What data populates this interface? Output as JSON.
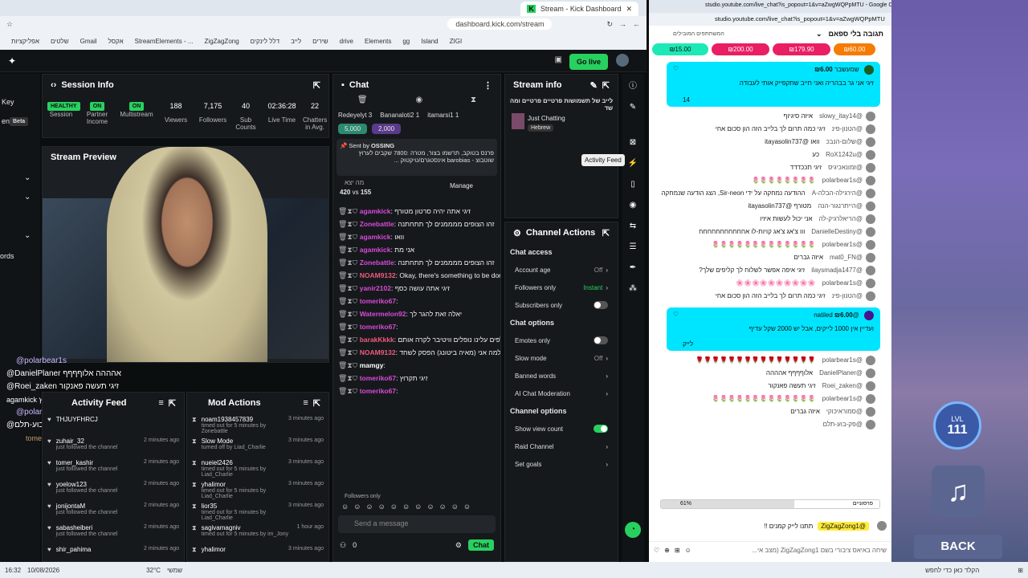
{
  "browser": {
    "tab_title": "Stream - Kick Dashboard",
    "url": "dashboard.kick.com/stream",
    "bookmarks": [
      "ZIGI",
      "Island",
      "gg",
      "Elements",
      "drive",
      "שירים",
      "לייב",
      "דלל לינקים",
      "ZigZagZong",
      "StreamElements - ...",
      "אקסל",
      "Gmail",
      "שלטים",
      "אפליקציות"
    ]
  },
  "kick": {
    "go_live": "Go live",
    "session": {
      "title": "Session Info",
      "badges": [
        "HEALTHY",
        "ON",
        "ON"
      ],
      "stats": [
        {
          "value": "188",
          "label": "Viewers"
        },
        {
          "value": "7,175",
          "label": "Followers"
        },
        {
          "value": "40",
          "label": "Sub Counts"
        },
        {
          "value": "02:36:28",
          "label": "Live Time"
        },
        {
          "value": "22",
          "label": "Chatters in Avg."
        }
      ],
      "badge_labels": [
        "Session",
        "Partner Income",
        "Multistream"
      ]
    },
    "left_labels": [
      "Key",
      "ent",
      "Beta",
      "ords"
    ],
    "stream_preview": "Stream Preview",
    "overlay_chat": [
      "@polarbear1s",
      "@DanielPlaner אהההה אלוףףףף",
      "@Roei_zaken זיגי תעשה פאנקור",
      "agamkick זיגי תקרוץ",
      "@polarbear1s",
      "@פק-בוע-תלם",
      "tomeriko67"
    ],
    "chat": {
      "title": "Chat",
      "top_users": [
        "Redeyelyt 3",
        "Bananaloti2 1",
        "itamarsi1 1"
      ],
      "kicks": [
        "5,000",
        "2,000"
      ],
      "pinned_by": "OSSING",
      "pinned_text": "פרנס בטוקב, תרשמו בצור, מטרה :7800 שקבים לערוץ שוטבוצ - barobias אינסטגרם/טיקטוק ...",
      "poll": {
        "label": "מה יצא",
        "a": "420",
        "vs": "vs",
        "b": "155",
        "manage": "Manage"
      },
      "messages": [
        {
          "user": "agamkick",
          "color": "#d94ad9",
          "text": "זיגי אתה יהיה סרטון מטורף"
        },
        {
          "user": "Zonebattle",
          "color": "#d94ad9",
          "text": "זהו הצופים ממממנים לך תתחתנה"
        },
        {
          "user": "agamkick",
          "color": "#d94ad9",
          "text": "וואו"
        },
        {
          "user": "agamkick",
          "color": "#d94ad9",
          "text": "אני מת"
        },
        {
          "user": "Zonebattle",
          "color": "#d94ad9",
          "text": "זהו הצופים ממממנים לך תתחתנה"
        },
        {
          "user": "NOAM9132",
          "color": "#f05a7e",
          "text": "Okay, there's something to be done about that."
        },
        {
          "user": "yanir2102",
          "color": "#d94ad9",
          "text": "זיגי אתה עושה כסף"
        },
        {
          "user": "tomeriko67",
          "color": "#d94ad9",
          "text": ""
        },
        {
          "user": "Watermelon92",
          "color": "#d94ad9",
          "text": "יאלה זאת להגר לך"
        },
        {
          "user": "tomeriko67",
          "color": "#d94ad9",
          "text": ""
        },
        {
          "user": "barakKkkk",
          "color": "#f05a7e",
          "text": "אלפים אלפים עלינו נופלים וויטיבר לקרה אותם"
        },
        {
          "user": "NOAM9132",
          "color": "#f05a7e",
          "text": "שאלה לא קשורה אבל אתה יודע למה אני (מאיה ביטונג) הפסק לשחד"
        },
        {
          "user": "mamgy",
          "color": "#fff",
          "text": ""
        },
        {
          "user": "tomeriko67",
          "color": "#d94ad9",
          "text": "זיגי תקרוץ"
        },
        {
          "user": "tomeriko67",
          "color": "#d94ad9",
          "text": ""
        }
      ],
      "followers_only": "Followers only",
      "placeholder": "Send a message",
      "points": "0",
      "send": "Chat"
    },
    "stream_info": {
      "title": "Stream info",
      "stream_title": "לייב של תשמושות פרטיים פרטיים ומה שד",
      "category": "Just Chatting",
      "lang": "Hebrew",
      "activity_feed_tip": "Activity Feed"
    },
    "channel_actions": {
      "title": "Channel Actions",
      "access": "Chat access",
      "rows1": [
        {
          "label": "Account age",
          "value": "Off"
        },
        {
          "label": "Followers only",
          "value": "Instant"
        },
        {
          "label": "Subscribers only",
          "value": ""
        }
      ],
      "options": "Chat options",
      "rows2": [
        {
          "label": "Emotes only",
          "value": ""
        },
        {
          "label": "Slow mode",
          "value": "Off"
        },
        {
          "label": "Banned words",
          "value": ""
        },
        {
          "label": "AI Chat Moderation",
          "value": ""
        }
      ],
      "channel_options": "Channel options",
      "rows3": [
        {
          "label": "Show view count",
          "value": ""
        },
        {
          "label": "Raid Channel",
          "value": ""
        },
        {
          "label": "Set goals",
          "value": ""
        }
      ]
    },
    "activity": {
      "title": "Activity Feed",
      "items": [
        {
          "user": "THJUYFHRCJ",
          "sub": "",
          "time": ""
        },
        {
          "user": "zuhair_32",
          "sub": "just followed the channel",
          "time": "2 minutes ago"
        },
        {
          "user": "tomer_kashir",
          "sub": "just followed the channel",
          "time": "2 minutes ago"
        },
        {
          "user": "yoelow123",
          "sub": "just followed the channel",
          "time": "2 minutes ago"
        },
        {
          "user": "jonijontaM",
          "sub": "just followed the channel",
          "time": "2 minutes ago"
        },
        {
          "user": "sabasheiberi",
          "sub": "just followed the channel",
          "time": "2 minutes ago"
        },
        {
          "user": "shir_pahima",
          "sub": "",
          "time": "2 minutes ago"
        }
      ]
    },
    "mod": {
      "title": "Mod Actions",
      "items": [
        {
          "user": "noam1938457839",
          "sub": "timed out for 5 minutes by Zonebattle",
          "time": "3 minutes ago"
        },
        {
          "user": "Slow Mode",
          "sub": "turned off by Liad_Charlie",
          "time": "3 minutes ago"
        },
        {
          "user": "nueiel2426",
          "sub": "timed out for 5 minutes by Liad_Charlie",
          "time": "3 minutes ago"
        },
        {
          "user": "yhalimor",
          "sub": "timed out for 5 minutes by Liad_Charlie",
          "time": "3 minutes ago"
        },
        {
          "user": "lior35",
          "sub": "timed out for 5 minutes by Liad_Charlie",
          "time": "3 minutes ago"
        },
        {
          "user": "sagivamagniv",
          "sub": "timed out for 5 minutes by im_Jony",
          "time": "1 hour ago"
        },
        {
          "user": "yhalimor",
          "sub": "",
          "time": "3 minutes ago"
        }
      ]
    }
  },
  "yt": {
    "window_title": "studio.youtube.com/live_chat?is_popout=1&v=aZwgWQPpMTU - Google Chrome",
    "url": "studio.youtube.com/live_chat?is_popout=1&v=aZwgWQPpMTU",
    "header": "תגובה בלי ספאם",
    "subheader": "המשתתפים המובילים",
    "superchats": [
      "₪15.00",
      "₪200.00",
      "₪179.90",
      "₪60.00"
    ],
    "sc1": {
      "name": "שמעשבר",
      "amount": "₪6.00",
      "text": "זיגי אני גר בבהריה ואני חייב שתקפייק אותי לעבודה",
      "likes": "14"
    },
    "messages": [
      {
        "user": "@slowy_itay14",
        "text": "איזה סיגיוף"
      },
      {
        "user": "@הטנון-פינ",
        "text": "זיגי כמה תרום לך בלייב הזה הון סכום אחי"
      },
      {
        "user": "@שלום-הנבכ",
        "text": "וואו @itayasolin737"
      },
      {
        "user": "@RoX1242u",
        "text": "כע"
      },
      {
        "user": "@זמונאכיגיס",
        "text": "זיגי תככדדד"
      },
      {
        "user": "@polarbear1s",
        "text": "🌷🌷🌷🌷🌷🌷🌷🌷"
      },
      {
        "user": "@הירגילה-הבלה-A",
        "text": "ההודעה נמחקה על ידי Sir-neon, הצג הודעה שנמחקה"
      },
      {
        "user": "@הייתרנגור-הנה",
        "text": "מטורף @itayasolin737"
      },
      {
        "user": "@הריאלרגיק-לה",
        "text": "אני יכול לעשות איזיו"
      },
      {
        "user": "@DanielleDestiny",
        "text": "ווו צ'אג צ'אג קויות-לו אחחחחחחחחחחח"
      },
      {
        "user": "@polarbear1s",
        "text": "🌷🌷🌷🌷🌷🌷🌷🌷🌷🌷🌷🌷🌷"
      },
      {
        "user": "@mat0_FN",
        "text": "איזה גברים"
      },
      {
        "user": "@ilaysmadja1477",
        "text": "זיגי איפה אפשר לשלוח לך קליפים שלך?"
      },
      {
        "user": "@polarbear1s",
        "text": "🌸🌸🌸🌸🌸🌸🌸🌸🌸🌸"
      },
      {
        "user": "@הטנון-פינ",
        "text": "זיגי כמה תרום לך בלייב הזה הון סכום אחי"
      }
    ],
    "sc2": {
      "name": "@natiled",
      "amount": "₪6.00",
      "text": "ועדיין אין 1000 לייקים, אבל יש 2000 שקל עדיף",
      "likes": "לייק"
    },
    "messages2": [
      {
        "user": "@polarbear1s",
        "text": "🌹🌹🌹🌹🌹🌹🌹🌹🌹🌹🌹🌹🌹🌹🌹"
      },
      {
        "user": "@DanielPlaner",
        "text": "אלוףףףף אהההה"
      },
      {
        "user": "@Roei_zaken",
        "text": "זיגי תעשה פאנקור"
      },
      {
        "user": "@polarbear1s",
        "text": "🌷🌷🌷🌷🌷🌷🌷🌷🌷🌷🌷🌷🌷"
      },
      {
        "user": "@סמוראיכוקי",
        "text": "איזה גברים"
      },
      {
        "user": "@פק-בוע-תלם",
        "text": ""
      }
    ],
    "progress_label": "61%",
    "progress_value": 0.61,
    "progress_right": "פרסוניים",
    "pinned_user": "@ZigZagZong1",
    "pinned_text": "תתנו לייק קמנים !!",
    "input_placeholder": "שיחה באיאס ציבורי בשם ZigZagZong1 (מצב אי..."
  },
  "game": {
    "level_label": "LVL",
    "level": "111",
    "back": "BACK"
  },
  "taskbar": {
    "time": "16:32",
    "date": "10/08/2026",
    "temp": "32°C",
    "weather": "שמשי",
    "search": "הקלד כאן כדי לחפש"
  }
}
